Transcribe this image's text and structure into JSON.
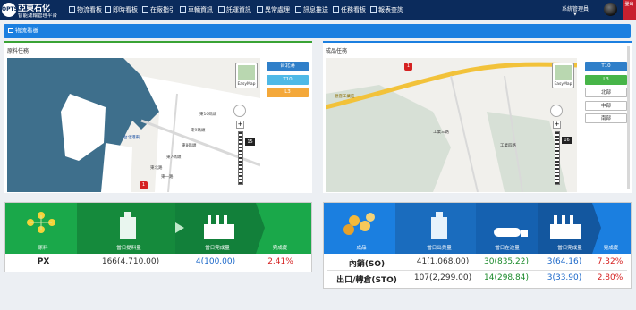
{
  "header": {
    "logo_badge": "OPTS",
    "logo_title": "亞東石化",
    "logo_subtitle": "智能運輸管理平台",
    "nav": [
      {
        "label": "物流看板",
        "icon": "dashboard-icon"
      },
      {
        "label": "即時看板",
        "icon": "realtime-icon"
      },
      {
        "label": "在廠指引",
        "icon": "plant-guide-icon"
      },
      {
        "label": "車輛資訊",
        "icon": "truck-icon"
      },
      {
        "label": "託運資訊",
        "icon": "consignment-icon"
      },
      {
        "label": "異常處理",
        "icon": "warning-icon"
      },
      {
        "label": "訊息推送",
        "icon": "message-icon"
      },
      {
        "label": "任務看板",
        "icon": "task-icon"
      },
      {
        "label": "報表查詢",
        "icon": "report-icon"
      }
    ],
    "user": "系統管理員",
    "user_caret": "▼",
    "logout": "登出"
  },
  "section": {
    "title": "物流看板",
    "icon": "dashboard-icon"
  },
  "raw_panel": {
    "title": "原料任務",
    "legend": [
      {
        "label": "台北港",
        "color": "#2f7fc9"
      },
      {
        "label": "T10",
        "color": "#4fb9e6"
      },
      {
        "label": "L3",
        "color": "#f4a83a"
      }
    ],
    "easymap": "EasyMap",
    "zoom_level": "15",
    "pin": "1",
    "labels": [
      "台北港東",
      "東8碼頭",
      "東7碼頭",
      "東9碼頭",
      "東10碼頭",
      "東北路",
      "東一路"
    ]
  },
  "product_panel": {
    "title": "成品任務",
    "legend": [
      {
        "label": "T10",
        "color": "#2f7fc9"
      },
      {
        "label": "L3",
        "color": "#47b548"
      },
      {
        "label": "北部",
        "color": "#ffffff"
      },
      {
        "label": "中部",
        "color": "#ffffff"
      },
      {
        "label": "南部",
        "color": "#ffffff"
      }
    ],
    "easymap": "EasyMap",
    "zoom_level": "16",
    "pin": "1",
    "labels": [
      "觀音工業區",
      "工業三路",
      "工業四路"
    ]
  },
  "raw_stats": {
    "headers": [
      "原料",
      "當日提料量",
      "當日完成量",
      "完成度"
    ],
    "rows": [
      {
        "name": "PX",
        "planned": "166(4,710.00)",
        "done": "4(100.00)",
        "rate": "2.41%"
      }
    ]
  },
  "product_stats": {
    "headers": [
      "成品",
      "當日出貨量",
      "當日在途量",
      "當日完成量",
      "完成度"
    ],
    "rows": [
      {
        "name": "內銷(SO)",
        "shipped": "41(1,068.00)",
        "transit": "30(835.22)",
        "done": "3(64.16)",
        "rate": "7.32%"
      },
      {
        "name": "出口/轉倉(STO)",
        "shipped": "107(2,299.00)",
        "transit": "14(298.84)",
        "done": "3(33.90)",
        "rate": "2.80%"
      }
    ]
  }
}
